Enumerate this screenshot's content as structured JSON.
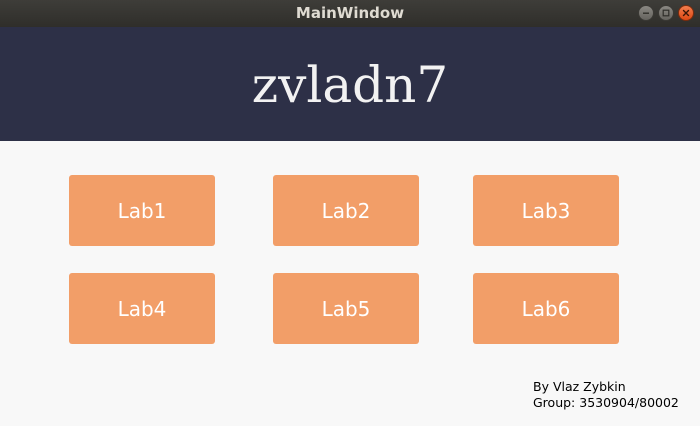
{
  "window": {
    "title": "MainWindow"
  },
  "header": {
    "title": "zvladn7",
    "background_color": "#2d3047"
  },
  "labs": [
    {
      "label": "Lab1"
    },
    {
      "label": "Lab2"
    },
    {
      "label": "Lab3"
    },
    {
      "label": "Lab4"
    },
    {
      "label": "Lab5"
    },
    {
      "label": "Lab6"
    }
  ],
  "button_color": "#f29e68",
  "credits": {
    "author": "By Vlaz Zybkin",
    "group": "Group: 3530904/80002"
  },
  "window_controls": [
    "minimize-icon",
    "maximize-icon",
    "close-icon"
  ]
}
